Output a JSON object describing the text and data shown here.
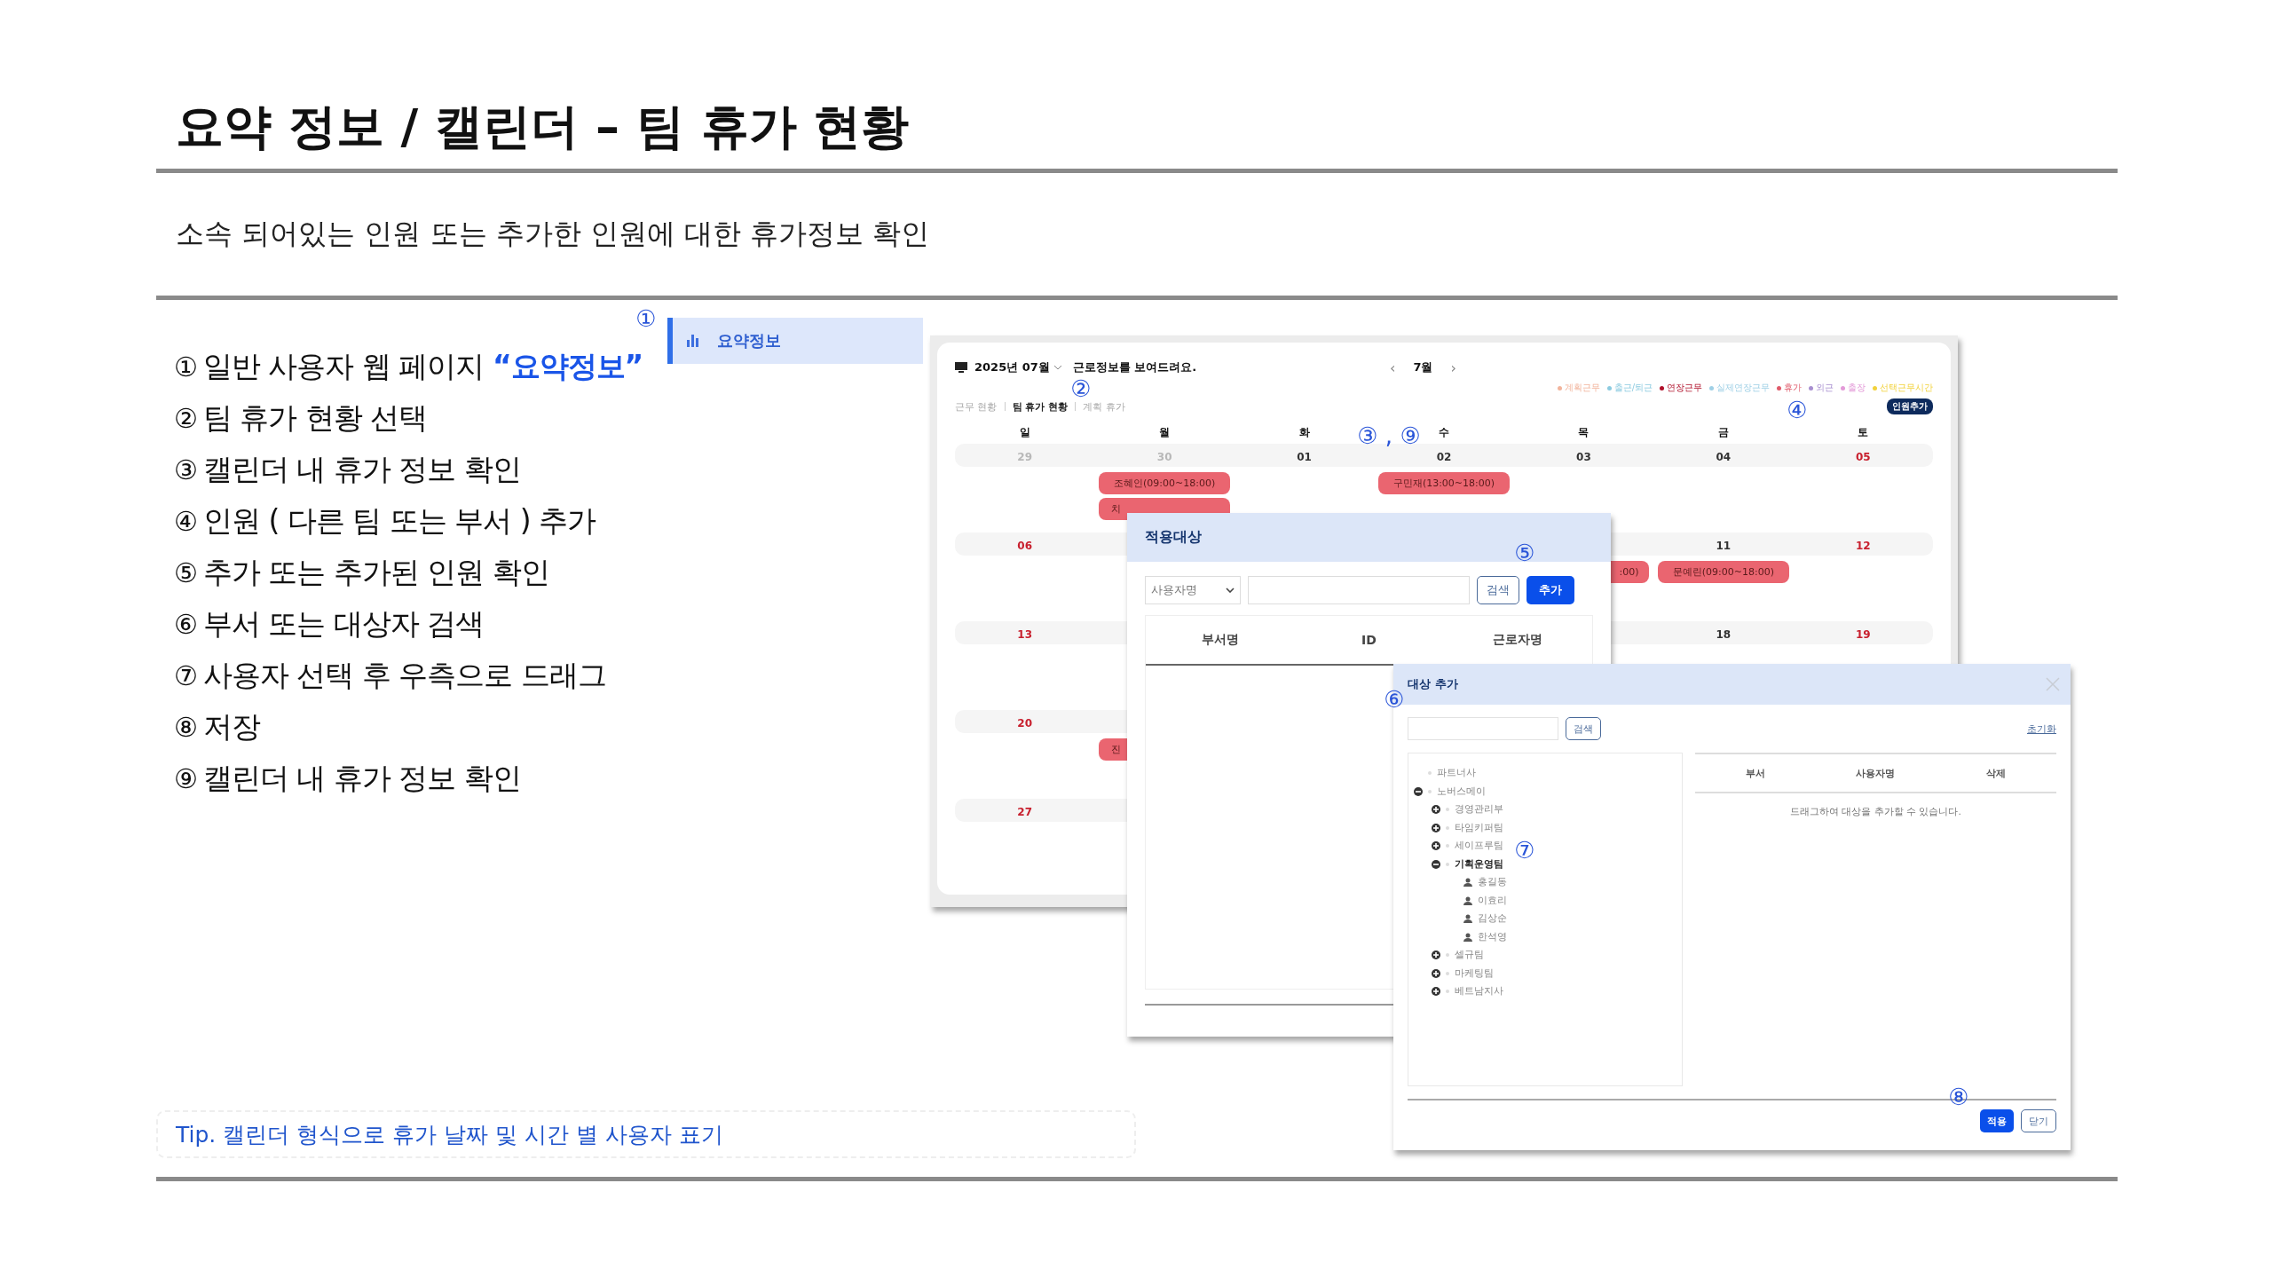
{
  "title": "요약 정보 / 캘린더 – 팀 휴가 현황",
  "subtitle": "소속 되어있는 인원 또는 추가한 인원에 대한 휴가정보 확인",
  "steps": [
    {
      "number": "①",
      "text": "일반 사용자 웹 페이지 ",
      "highlight": "“요약정보”"
    },
    {
      "number": "②",
      "text": "팀 휴가 현황 선택"
    },
    {
      "number": "③",
      "text": "캘린더 내 휴가 정보 확인"
    },
    {
      "number": "④",
      "text": "인원 ( 다른 팀 또는 부서 ) 추가"
    },
    {
      "number": "⑤",
      "text": "추가 또는 추가된 인원 확인"
    },
    {
      "number": "⑥",
      "text": "부서 또는 대상자 검색"
    },
    {
      "number": "⑦",
      "text": "사용자 선택 후 우측으로 드래그"
    },
    {
      "number": "⑧",
      "text": "저장"
    },
    {
      "number": "⑨",
      "text": "캘린더 내 휴가 정보 확인"
    }
  ],
  "tip": "Tip. 캘린더 형식으로 휴가 날짜 및 시간 별 사용자 표기",
  "sidebar": {
    "items": [
      {
        "label": "요약정보",
        "selected": true
      }
    ]
  },
  "calendar": {
    "month_select": "2025년 07월",
    "message": "근로정보를 보여드려요.",
    "nav": {
      "prev": "‹",
      "label": "7월",
      "next": "›"
    },
    "legend": [
      {
        "label": "계획근무",
        "color": "#f2b49c"
      },
      {
        "label": "출근/퇴근",
        "color": "#8ccbe0"
      },
      {
        "label": "연장근무",
        "color": "#b0102a"
      },
      {
        "label": "실제연장근무",
        "color": "#9fd0e6"
      },
      {
        "label": "휴가",
        "color": "#e05a6a"
      },
      {
        "label": "외근",
        "color": "#a88fd0"
      },
      {
        "label": "출장",
        "color": "#e39ad8"
      },
      {
        "label": "선택근무시간",
        "color": "#f2d23c"
      }
    ],
    "tabs": [
      {
        "label": "근무 현황",
        "selected": false
      },
      {
        "label": "팀 휴가 현황",
        "selected": true
      },
      {
        "label": "계획 휴가",
        "selected": false
      }
    ],
    "add_button": "인원추가",
    "weekdays": [
      "일",
      "월",
      "화",
      "수",
      "목",
      "금",
      "토"
    ],
    "weeks": [
      {
        "sun": {
          "label": "29",
          "other_month": true,
          "holiday": false
        },
        "mon": {
          "label": "30",
          "other_month": true,
          "holiday": false,
          "events": [
            {
              "text": "조혜인(09:00~18:00)",
              "covered_left": false,
              "covered_right": false
            },
            {
              "text": "치",
              "covered_left": false,
              "covered_right": true
            }
          ]
        },
        "tue": {
          "label": "01",
          "other_month": false,
          "holiday": false
        },
        "wed": {
          "label": "02",
          "other_month": false,
          "holiday": false,
          "events": [
            {
              "text": "구민재(13:00~18:00)",
              "covered_left": false,
              "covered_right": false
            }
          ]
        },
        "thu": {
          "label": "03",
          "other_month": false,
          "holiday": false
        },
        "fri": {
          "label": "04",
          "other_month": false,
          "holiday": false
        },
        "sat": {
          "label": "05",
          "other_month": false,
          "holiday": true
        }
      },
      {
        "sun": {
          "label": "06",
          "other_month": false,
          "holiday": true
        },
        "thu": {
          "events": [
            {
              "text": ":00)",
              "covered_left": true,
              "covered_right": false
            }
          ]
        },
        "fri": {
          "label": "11",
          "other_month": false,
          "holiday": false,
          "events": [
            {
              "text": "문예린(09:00~18:00)",
              "covered_left": false,
              "covered_right": false
            }
          ]
        },
        "sat": {
          "label": "12",
          "other_month": false,
          "holiday": true
        }
      },
      {
        "sun": {
          "label": "13",
          "other_month": false,
          "holiday": true
        },
        "fri": {
          "label": "18",
          "other_month": false,
          "holiday": false
        },
        "sat": {
          "label": "19",
          "other_month": false,
          "holiday": true
        }
      },
      {
        "sun": {
          "label": "20",
          "other_month": false,
          "holiday": true
        },
        "mon": {
          "events": [
            {
              "text": "진",
              "covered_left": false,
              "covered_right": true
            }
          ]
        }
      },
      {
        "sun": {
          "label": "27",
          "other_month": false,
          "holiday": true
        }
      }
    ]
  },
  "apply_dialog": {
    "title": "적용대상",
    "select": "사용자명",
    "search_button": "검색",
    "add_button": "추가",
    "columns": [
      "부서명",
      "ID",
      "근로자명"
    ]
  },
  "add_dialog": {
    "title": "대상 추가",
    "search_button": "검색",
    "reset_link": "초기화",
    "tree": [
      {
        "label": "파트너사",
        "kind": "group",
        "selected": false
      },
      {
        "label": "노버스메이",
        "kind": "group",
        "expanded": true,
        "selected": false,
        "children": [
          {
            "label": "경영관리부",
            "kind": "group",
            "expanded": false,
            "selected": false
          },
          {
            "label": "타임키퍼팀",
            "kind": "group",
            "expanded": false,
            "selected": false
          },
          {
            "label": "세이프루팀",
            "kind": "group",
            "expanded": false,
            "selected": false
          },
          {
            "label": "기획운영팀",
            "kind": "group",
            "expanded": true,
            "selected": true,
            "children": [
              {
                "label": "홍길동",
                "kind": "person",
                "selected": false
              },
              {
                "label": "이효리",
                "kind": "person",
                "selected": false
              },
              {
                "label": "김상순",
                "kind": "person",
                "selected": false
              },
              {
                "label": "한석영",
                "kind": "person",
                "selected": false
              }
            ]
          },
          {
            "label": "셀규팀",
            "kind": "group",
            "expanded": false,
            "selected": false
          },
          {
            "label": "마케팅팀",
            "kind": "group",
            "expanded": false,
            "selected": false
          },
          {
            "label": "베트남지사",
            "kind": "group",
            "expanded": false,
            "selected": false
          }
        ]
      }
    ],
    "columns": [
      "부서",
      "사용자명",
      "삭제"
    ],
    "empty_message": "드래그하여 대상을 추가할 수 있습니다.",
    "apply_button": "적용",
    "close_button": "닫기"
  },
  "callouts": [
    "①",
    "②",
    "③ , ⑨",
    "④",
    "⑤",
    "⑥",
    "⑦",
    "⑧"
  ]
}
